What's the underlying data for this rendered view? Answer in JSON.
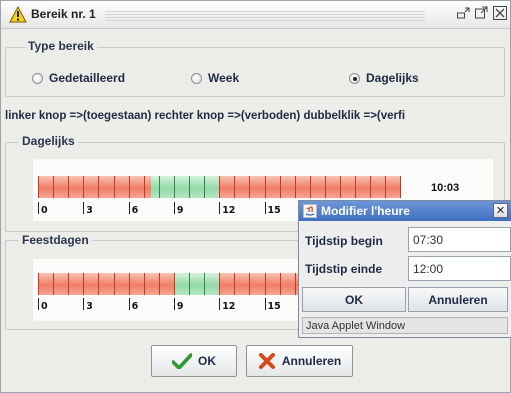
{
  "window": {
    "title": "Bereik nr. 1",
    "controls": [
      "minimize-icon",
      "maximize-icon",
      "close-icon"
    ]
  },
  "type_group": {
    "title": "Type bereik",
    "options": [
      {
        "label": "Gedetailleerd",
        "selected": false
      },
      {
        "label": "Week",
        "selected": false
      },
      {
        "label": "Dagelijks",
        "selected": true
      }
    ]
  },
  "hint": "linker knop =>(toegestaan)  rechter knop =>(verboden)  dubbelklik =>(verfi",
  "daily": {
    "title": "Dagelijks",
    "time": "10:03",
    "scale_labels": [
      "0",
      "3",
      "6",
      "9",
      "12",
      "15"
    ],
    "allowed_hours": [
      7.5,
      12
    ]
  },
  "holidays": {
    "title": "Feestdagen",
    "scale_labels": [
      "0",
      "3",
      "6",
      "9",
      "12",
      "15"
    ],
    "allowed_hours": [
      9,
      12
    ]
  },
  "buttons": {
    "ok": "OK",
    "cancel": "Annuleren"
  },
  "dialog": {
    "title": "Modifier l'heure",
    "begin_label": "Tijdstip begin",
    "begin_value": "07:30",
    "end_label": "Tijdstip einde",
    "end_value": "12:00",
    "ok": "OK",
    "cancel": "Annuleren",
    "status": "Java Applet Window"
  },
  "colors": {
    "allowed": "#93d9a8",
    "forbidden": "#f07d64",
    "dialog_title": "#4a78c6"
  }
}
